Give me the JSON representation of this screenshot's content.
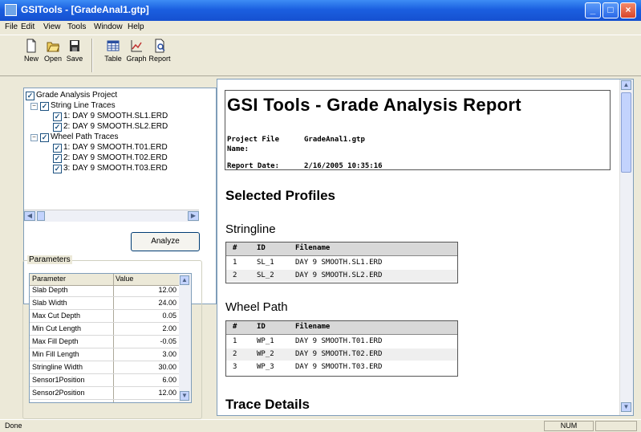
{
  "window": {
    "title": "GSITools - [GradeAnal1.gtp]"
  },
  "menu": [
    "File",
    "Edit",
    "View",
    "Tools",
    "Window",
    "Help"
  ],
  "toolbar": [
    {
      "label": "New",
      "icon": "new-document-icon"
    },
    {
      "label": "Open",
      "icon": "open-folder-icon"
    },
    {
      "label": "Save",
      "icon": "save-disk-icon"
    },
    {
      "label": "Table",
      "icon": "table-icon"
    },
    {
      "label": "Graph",
      "icon": "graph-icon"
    },
    {
      "label": "Report",
      "icon": "report-icon"
    }
  ],
  "tree": {
    "root": "Grade Analysis Project",
    "groups": [
      {
        "label": "String Line Traces",
        "items": [
          "1: DAY 9 SMOOTH.SL1.ERD",
          "2: DAY 9 SMOOTH.SL2.ERD"
        ]
      },
      {
        "label": "Wheel Path Traces",
        "items": [
          "1: DAY 9 SMOOTH.T01.ERD",
          "2: DAY 9 SMOOTH.T02.ERD",
          "3: DAY 9 SMOOTH.T03.ERD"
        ]
      }
    ]
  },
  "analyze_label": "Analyze",
  "parameters": {
    "legend": "Parameters",
    "headers": [
      "Parameter",
      "Value"
    ],
    "rows": [
      [
        "Slab Depth",
        "12.00"
      ],
      [
        "Slab Width",
        "24.00"
      ],
      [
        "Max Cut Depth",
        "0.05"
      ],
      [
        "Min Cut Length",
        "2.00"
      ],
      [
        "Max Fill Depth",
        "-0.05"
      ],
      [
        "Min Fill Length",
        "3.00"
      ],
      [
        "Stringline Width",
        "30.00"
      ],
      [
        "Sensor1Position",
        "6.00"
      ],
      [
        "Sensor2Position",
        "12.00"
      ]
    ]
  },
  "report": {
    "title": "GSI Tools - Grade Analysis Report",
    "project_file_label": "Project File",
    "project_file_label2": "Name:",
    "project_file_value": "GradeAnal1.gtp",
    "report_date_label": "Report Date:",
    "report_date_value": "2/16/2005 10:35:16",
    "selected_profiles": "Selected Profiles",
    "stringline_heading": "Stringline",
    "wheelpath_heading": "Wheel Path",
    "table_headers": [
      "#",
      "ID",
      "Filename"
    ],
    "stringline_rows": [
      [
        "1",
        "SL_1",
        "DAY 9 SMOOTH.SL1.ERD"
      ],
      [
        "2",
        "SL_2",
        "DAY 9 SMOOTH.SL2.ERD"
      ]
    ],
    "wheelpath_rows": [
      [
        "1",
        "WP_1",
        "DAY 9 SMOOTH.T01.ERD"
      ],
      [
        "2",
        "WP_2",
        "DAY 9 SMOOTH.T02.ERD"
      ],
      [
        "3",
        "WP_3",
        "DAY 9 SMOOTH.T03.ERD"
      ]
    ],
    "trace_details": "Trace Details"
  },
  "status": {
    "text": "Done",
    "num": "NUM"
  }
}
